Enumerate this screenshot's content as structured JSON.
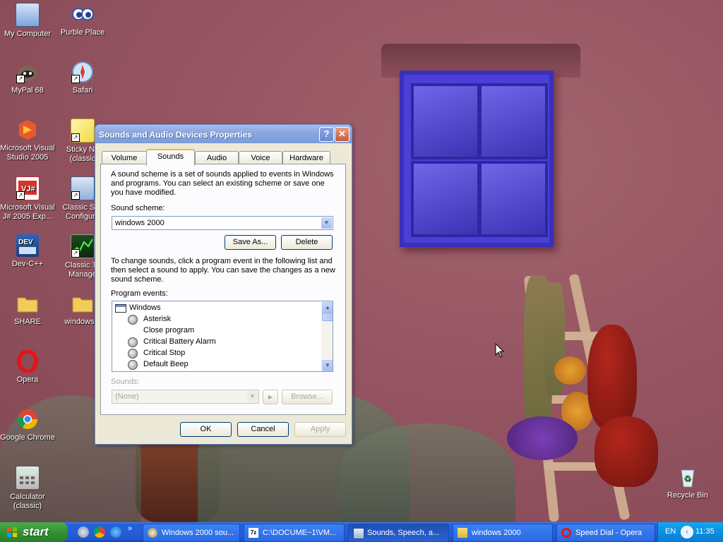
{
  "desktop": {
    "icons": [
      {
        "label": "My Computer",
        "icon": "my-computer-icon"
      },
      {
        "label": "Purble Place",
        "icon": "purble-place-icon"
      },
      {
        "label": "MyPal 68",
        "icon": "mypal-icon"
      },
      {
        "label": "Safari",
        "icon": "safari-icon"
      },
      {
        "label": "Microsoft Visual Studio 2005",
        "icon": "visual-studio-icon"
      },
      {
        "label": "Sticky No (classic",
        "icon": "sticky-notes-icon"
      },
      {
        "label": "Microsoft Visual J# 2005 Exp...",
        "icon": "visual-jsharp-icon"
      },
      {
        "label": "Classic Sys Configura",
        "icon": "system-config-icon"
      },
      {
        "label": "Dev-C++",
        "icon": "dev-cpp-icon"
      },
      {
        "label": "Classic Ta Manage",
        "icon": "task-manager-icon"
      },
      {
        "label": "SHARE",
        "icon": "folder-icon"
      },
      {
        "label": "windows 2",
        "icon": "folder-icon"
      },
      {
        "label": "Opera",
        "icon": "opera-icon"
      },
      {
        "label": "Google Chrome",
        "icon": "chrome-icon"
      },
      {
        "label": "Calculator (classic)",
        "icon": "calculator-icon"
      },
      {
        "label": "Recycle Bin",
        "icon": "recycle-bin-icon"
      }
    ]
  },
  "dialog": {
    "title": "Sounds and Audio Devices Properties",
    "help_glyph": "?",
    "close_glyph": "✕",
    "tabs": [
      {
        "label": "Volume"
      },
      {
        "label": "Sounds",
        "active": true
      },
      {
        "label": "Audio"
      },
      {
        "label": "Voice"
      },
      {
        "label": "Hardware"
      }
    ],
    "intro_text": "A sound scheme is a set of sounds applied to events in Windows and programs. You can select an existing scheme or save one you have modified.",
    "scheme_label": "Sound scheme:",
    "scheme_value": "windows 2000",
    "save_as_label": "Save As...",
    "delete_label": "Delete",
    "change_text": "To change sounds, click a program event in the following list and then select a sound to apply. You can save the changes as a new sound scheme.",
    "events_label": "Program events:",
    "events": [
      {
        "label": "Windows",
        "level": 0,
        "has_sound": false
      },
      {
        "label": "Asterisk",
        "level": 1,
        "has_sound": true
      },
      {
        "label": "Close program",
        "level": 1,
        "has_sound": false
      },
      {
        "label": "Critical Battery Alarm",
        "level": 1,
        "has_sound": true
      },
      {
        "label": "Critical Stop",
        "level": 1,
        "has_sound": true
      },
      {
        "label": "Default Beep",
        "level": 1,
        "has_sound": true
      }
    ],
    "sounds_label": "Sounds:",
    "sounds_value": "(None)",
    "play_glyph": "▶",
    "browse_label": "Browse...",
    "ok_label": "OK",
    "cancel_label": "Cancel",
    "apply_label": "Apply"
  },
  "taskbar": {
    "start_label": "start",
    "overflow_glyph": "»",
    "tasks": [
      {
        "label": "Windows 2000 sou...",
        "icon": "media-icon"
      },
      {
        "label": "C:\\DOCUME~1\\VM...",
        "icon": "7zip-icon"
      },
      {
        "label": "Sounds, Speech, a...",
        "icon": "control-panel-icon",
        "active": true
      },
      {
        "label": "windows 2000",
        "icon": "folder-icon"
      },
      {
        "label": "Speed Dial - Opera",
        "icon": "opera-icon"
      }
    ],
    "language": "EN",
    "time": "11:35"
  },
  "colors": {
    "dialog_bg": "#ece9d8",
    "title_gradient_start": "#a6bfe8",
    "taskbar_blue": "#245edb",
    "start_green": "#3c9a3c",
    "tray_blue": "#0c8fe2"
  }
}
